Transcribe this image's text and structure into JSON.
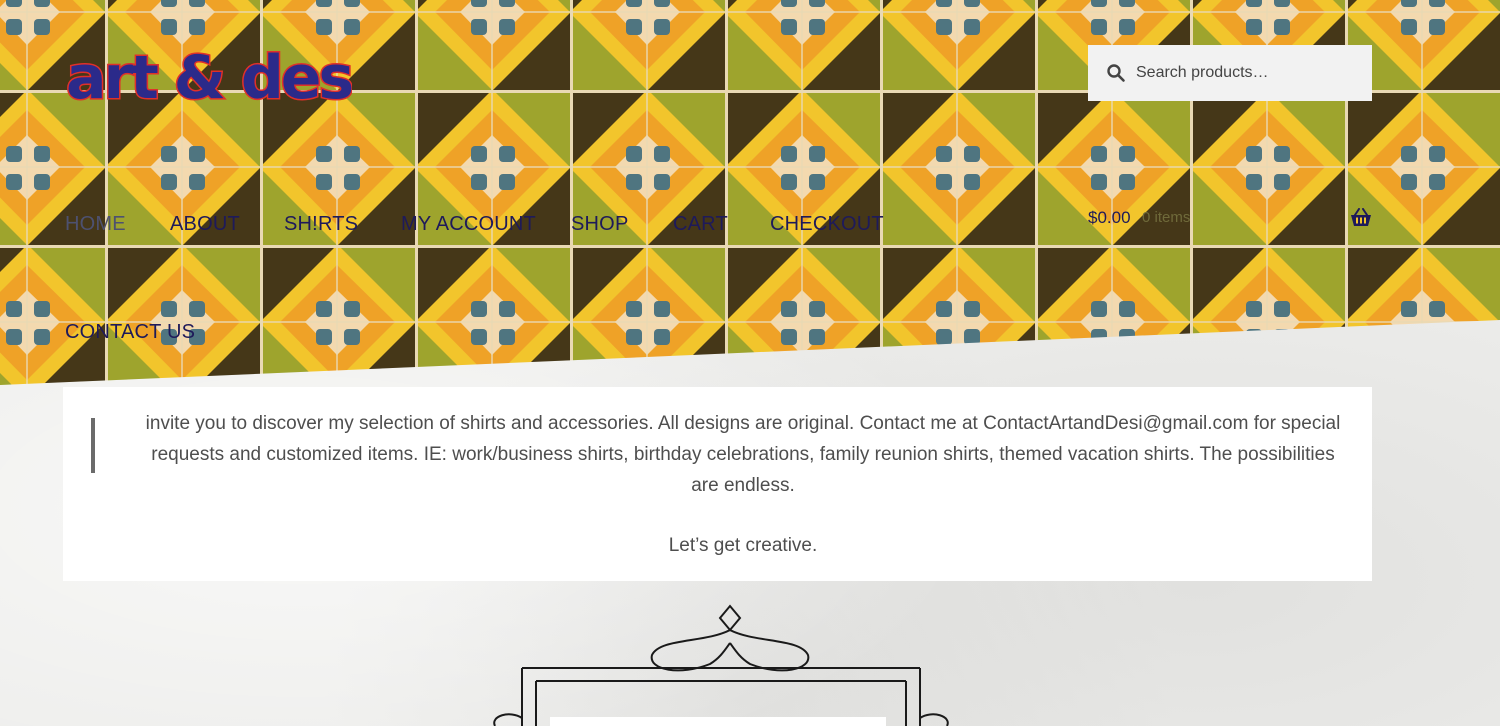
{
  "brand": {
    "logo_alt": "art & desi"
  },
  "search": {
    "placeholder": "Search products…"
  },
  "nav": {
    "items": [
      {
        "label": "HOME",
        "active": true
      },
      {
        "label": "ABOUT"
      },
      {
        "label": "SH!RTS"
      },
      {
        "label": "MY ACCOUNT"
      },
      {
        "label": "SHOP"
      },
      {
        "label": "CART"
      },
      {
        "label": "CHECKOUT"
      },
      {
        "label": "CONTACT US"
      }
    ]
  },
  "cart": {
    "total": "$0.00",
    "count": "0 items"
  },
  "main": {
    "intro": "invite you to discover my selection of shirts and accessories. All designs are original. Contact me at ContactArtandDesi@gmail.com for special requests and customized items. IE: work/business shirts, birthday celebrations, family reunion shirts, themed vacation shirts. The possibilities are endless.",
    "tagline": "Let’s get creative."
  },
  "colors": {
    "nav_text": "#1e1a5a",
    "nav_active": "#4d5170",
    "tile_yellow": "#f2c21a",
    "tile_orange": "#f0a224",
    "tile_green": "#8f9a2a",
    "tile_dark": "#2e2414",
    "tile_blue": "#1e4f8a",
    "logo_fill": "#2b2a8a",
    "logo_outline": "#e0302a"
  }
}
